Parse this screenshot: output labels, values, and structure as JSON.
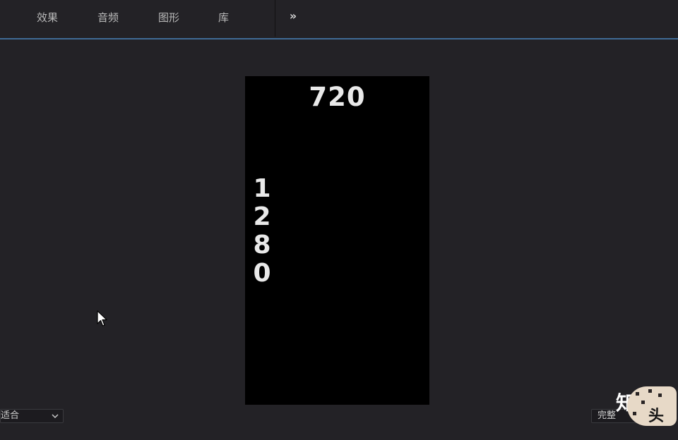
{
  "toolbar": {
    "tabs": [
      {
        "label": "效果"
      },
      {
        "label": "音频"
      },
      {
        "label": "图形"
      },
      {
        "label": "库"
      }
    ],
    "overflow_label": "»"
  },
  "canvas": {
    "width_label": "720",
    "height_label": "1280"
  },
  "footer": {
    "zoom_value": "适合",
    "quality_value": "完整"
  },
  "watermark": {
    "text_top": "知",
    "text_bottom": "头条"
  },
  "colors": {
    "background": "#232226",
    "accent_line": "#3f6b96",
    "canvas": "#000000",
    "canvas_text": "#e9e9e9"
  }
}
